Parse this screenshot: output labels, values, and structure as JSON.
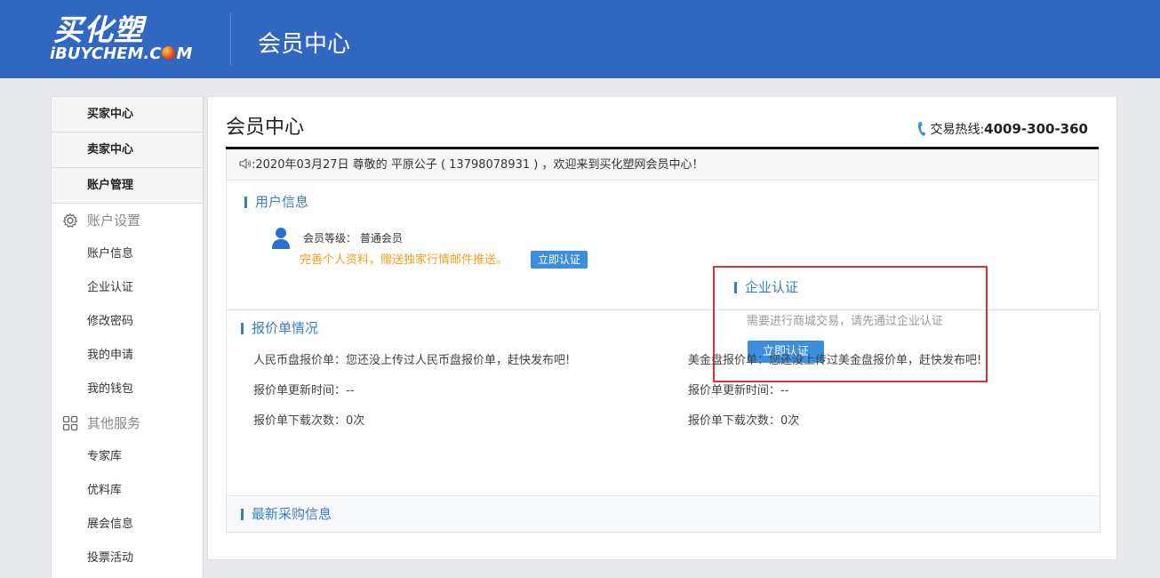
{
  "header": {
    "logo_cn": "买化塑",
    "logo_en_pre": "iBUYCHEM.C",
    "logo_en_post": "M",
    "title": "会员中心"
  },
  "sidebar": {
    "top_items": [
      "买家中心",
      "卖家中心",
      "账户管理"
    ],
    "groups": [
      {
        "label": "账户设置",
        "icon": "gear-icon",
        "items": [
          "账户信息",
          "企业认证",
          "修改密码",
          "我的申请",
          "我的钱包"
        ]
      },
      {
        "label": "其他服务",
        "icon": "grid-icon",
        "items": [
          "专家库",
          "优料库",
          "展会信息",
          "投票活动"
        ]
      }
    ]
  },
  "main": {
    "title": "会员中心",
    "hotline_label": "交易热线:",
    "hotline_number": "4009-300-360",
    "notice": ":2020年03月27日 尊敬的 平原公子 ( 13798078931 ) ，欢迎来到买化塑网会员中心！",
    "user_info": {
      "heading": "用户信息",
      "level_label": "会员等级：  普通会员",
      "promo": "完善个人资料，赠送独家行情邮件推送。",
      "button": "立即认证"
    },
    "enterprise": {
      "heading": "企业认证",
      "description": "需要进行商城交易，请先通过企业认证",
      "button": "立即认证"
    },
    "quotes": {
      "heading": "报价单情况",
      "rmb": "人民币盘报价单：您还没上传过人民币盘报价单，赶快发布吧!",
      "usd": "美金盘报价单：您还没上传过美金盘报价单，赶快发布吧!",
      "rmb_update": "报价单更新时间：--",
      "usd_update": "报价单更新时间：--",
      "rmb_downloads": "报价单下载次数：0次",
      "usd_downloads": "报价单下载次数：0次"
    },
    "latest_heading": "最新采购信息"
  },
  "colors": {
    "header_bg": "#3067c0",
    "accent_blue": "#3c7dbf",
    "button_blue": "#3c8fdc",
    "promo_orange": "#f0a020",
    "highlight_red": "#e03131"
  }
}
